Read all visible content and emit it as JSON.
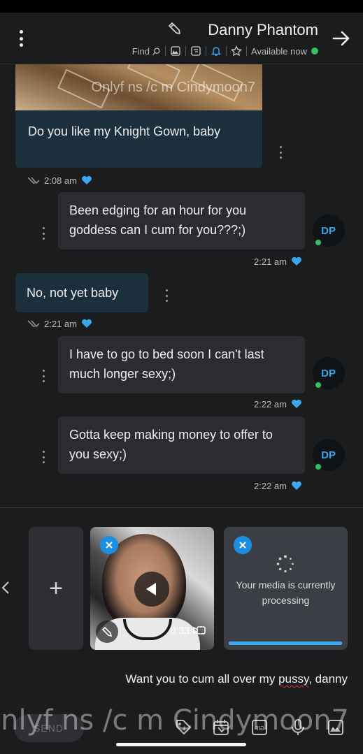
{
  "header": {
    "contact_name": "Danny Phantom",
    "status_text": "Available now",
    "find_label": "Find",
    "icons": [
      "back-arrow-icon",
      "pencil-icon",
      "star-icon",
      "bell-icon",
      "note-icon",
      "image-icon",
      "search-icon",
      "more-vertical-icon"
    ],
    "status_color": "#35c05e",
    "accent_color": "#3aa8ef"
  },
  "messages": [
    {
      "side": "creator",
      "type": "photo",
      "watermark": "Onlyf ns /c m Cindymoon7",
      "text": "Do you like my Knight Gown, baby",
      "time": "2:08 am",
      "liked": true,
      "read": true
    },
    {
      "side": "fan",
      "avatar": "DP",
      "text": "Been edging for an hour for you goddess can I cum for you???;)",
      "time": "2:21 am",
      "liked": true
    },
    {
      "side": "creator",
      "text": "No, not yet baby",
      "time": "2:21 am",
      "liked": true,
      "read": true
    },
    {
      "side": "fan",
      "avatar": "DP",
      "text": "I have to go to bed soon I can't last much longer sexy;)",
      "time": "2:22 am",
      "liked": true
    },
    {
      "side": "fan",
      "avatar": "DP",
      "text": "Gotta keep making money to offer to you sexy;)",
      "time": "2:22 am",
      "liked": true
    }
  ],
  "attachments": {
    "processing": {
      "text": "Your media is currently processing",
      "progress": 1.0
    },
    "video": {
      "duration": "0:33"
    },
    "add_label": "+"
  },
  "composer": {
    "message_before": "Want you to cum all over my ",
    "message_squiggle": "pussy",
    "message_after": ", danny",
    "send_label": "SEND",
    "watermark": "Onlyf ns /c m Cindymoon7",
    "toolbar_icons": [
      "image-icon",
      "microphone-icon",
      "gif-icon",
      "calendar-icon",
      "price-tag-icon"
    ]
  }
}
